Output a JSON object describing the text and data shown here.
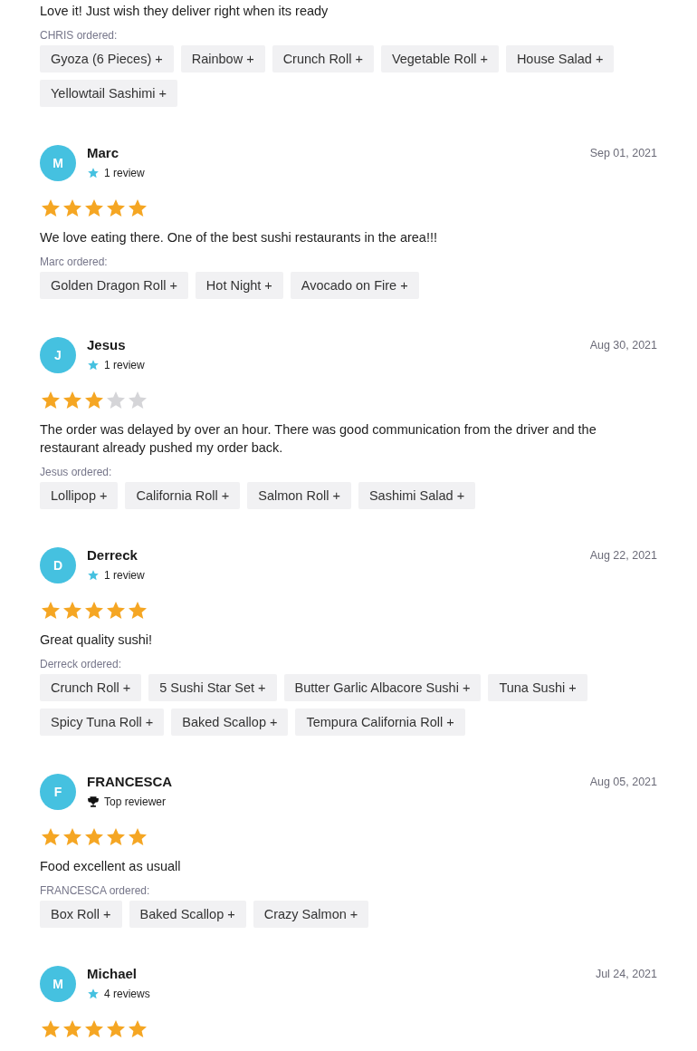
{
  "reviews": [
    {
      "comment": "Love it! Just wish they deliver right when its ready",
      "ordered_label": "CHRIS ordered:",
      "items": [
        "Gyoza (6 Pieces) +",
        "Rainbow +",
        "Crunch Roll +",
        "Vegetable Roll +",
        "House Salad +",
        "Yellowtail Sashimi +"
      ]
    },
    {
      "initial": "M",
      "name": "Marc",
      "badge": {
        "kind": "reviews",
        "text": "1 review"
      },
      "date": "Sep 01, 2021",
      "stars": 5,
      "comment": "We love eating there. One of the best sushi restaurants in the area!!!",
      "ordered_label": "Marc ordered:",
      "items": [
        "Golden Dragon Roll +",
        "Hot Night +",
        "Avocado on Fire +"
      ]
    },
    {
      "initial": "J",
      "name": "Jesus",
      "badge": {
        "kind": "reviews",
        "text": "1 review"
      },
      "date": "Aug 30, 2021",
      "stars": 3,
      "comment": "The order was delayed by over an hour. There was good communication from the driver and the restaurant already pushed my order back.",
      "ordered_label": "Jesus ordered:",
      "items": [
        "Lollipop +",
        "California Roll +",
        "Salmon Roll +",
        "Sashimi Salad +"
      ]
    },
    {
      "initial": "D",
      "name": "Derreck",
      "badge": {
        "kind": "reviews",
        "text": "1 review"
      },
      "date": "Aug 22, 2021",
      "stars": 5,
      "comment": "Great quality sushi!",
      "ordered_label": "Derreck ordered:",
      "items": [
        "Crunch Roll +",
        "5 Sushi Star Set +",
        "Butter Garlic Albacore Sushi +",
        "Tuna Sushi +",
        "Spicy Tuna Roll +",
        "Baked Scallop +",
        "Tempura California Roll +"
      ]
    },
    {
      "initial": "F",
      "name": "FRANCESCA",
      "badge": {
        "kind": "top",
        "text": "Top reviewer"
      },
      "date": "Aug 05, 2021",
      "stars": 5,
      "comment": "Food excellent as usuall",
      "ordered_label": "FRANCESCA ordered:",
      "items": [
        "Box Roll +",
        "Baked Scallop +",
        "Crazy Salmon +"
      ]
    },
    {
      "initial": "M",
      "name": "Michael",
      "badge": {
        "kind": "reviews",
        "text": "4 reviews"
      },
      "date": "Jul 24, 2021",
      "stars": 5
    }
  ]
}
